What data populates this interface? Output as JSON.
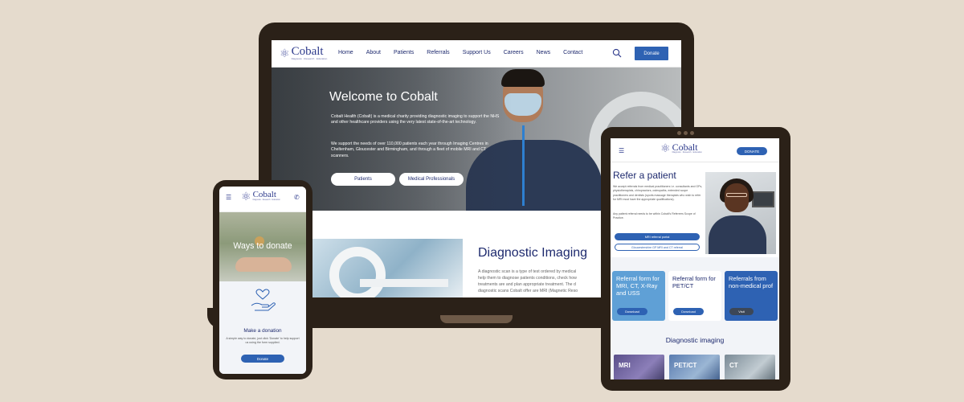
{
  "brand": {
    "name": "Cobalt",
    "tagline": "Diagnosis · Research · Education",
    "mark": "⚛",
    "primary": "#2e62b3",
    "dark_blue": "#1e2a6e"
  },
  "laptop": {
    "nav": [
      "Home",
      "About",
      "Patients",
      "Referrals",
      "Support Us",
      "Careers",
      "News",
      "Contact"
    ],
    "donate": "Donate",
    "hero": {
      "title": "Welcome to Cobalt",
      "p1": "Cobalt Health (Cobalt) is a medical charity providing diagnostic imaging to support the NHS and other healthcare providers using the very latest state-of-the-art technology.",
      "p2": "We support the needs of over 110,000 patients each year through Imaging Centres in Cheltenham, Gloucester and Birmingham, and through a fleet of mobile MRI and CT scanners.",
      "btn_patients": "Patients",
      "btn_professionals": "Medical Professionals"
    },
    "diagnostic": {
      "title": "Diagnostic Imaging",
      "lines": [
        "A diagnostic scan is a type of test ordered by medical",
        "help them to diagnose patients conditions, check how",
        "treatments are and plan appropriate treatment. The d",
        "diagnostic scans Cobalt offer are MRI (Magnetic Reso"
      ]
    }
  },
  "tablet": {
    "donate": "DONATE",
    "refer": {
      "title": "Refer a patient",
      "p1": "We accept referrals from medical practitioners i.e. consultants and GPs, physiotherapists, chiropractors, osteopaths, extended scope practitioners and dentists (sports massage therapists who wish to refer for MRI must have the appropriate qualifications).",
      "p2": "Any patient referral needs to be within Cobalt's Referrers Scope of Practice.",
      "portal": "MRI referral portal",
      "glos": "Gloucestershire GP MRI and CT referral"
    },
    "cards": [
      {
        "title": "Referral form for MRI, CT, X-Ray and USS",
        "button": "Download"
      },
      {
        "title": "Referral form for PET/CT",
        "button": "Download"
      },
      {
        "title": "Referrals from non-medical prof",
        "button": "Visit"
      }
    ],
    "diag_title": "Diagnostic imaging",
    "tiles": [
      "MRI",
      "PET/CT",
      "CT"
    ]
  },
  "phone": {
    "hero_title": "Ways to donate",
    "make_title": "Make a donation",
    "make_desc": "A simple way to donate, just click 'Donate' to help support us using the form supplied.",
    "donate": "Donate"
  }
}
